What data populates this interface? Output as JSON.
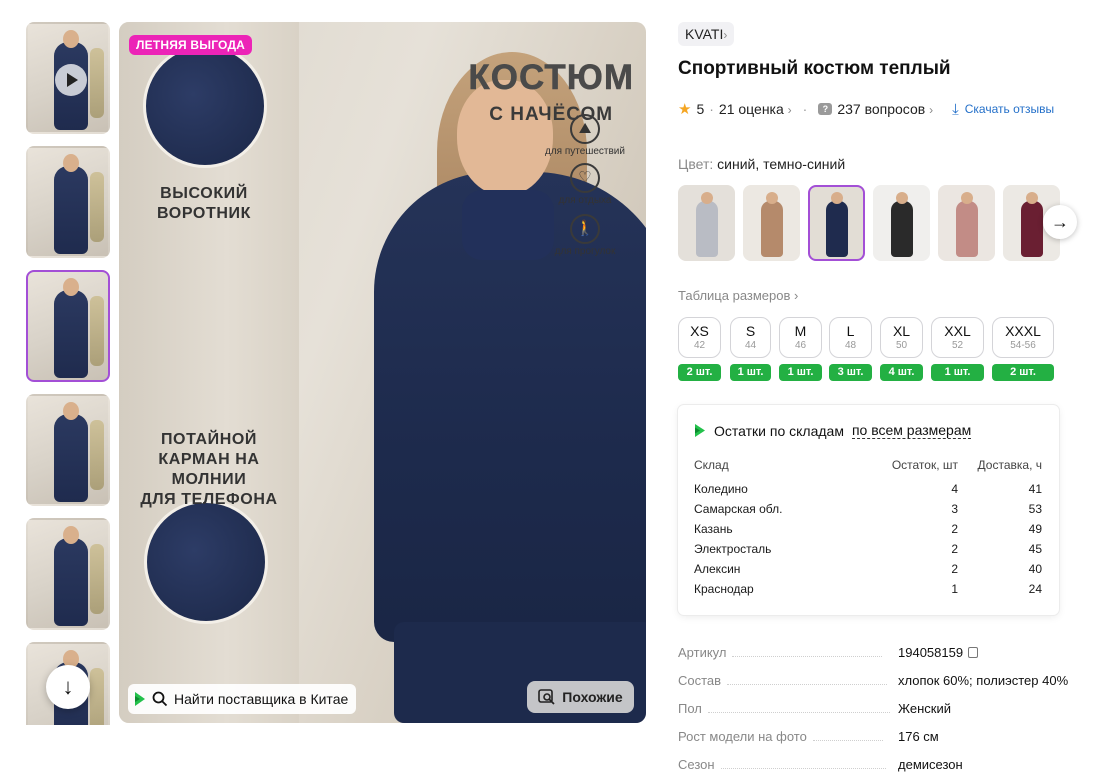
{
  "gallery": {
    "thumbnail_count": 6,
    "active_thumbnail": 3,
    "scroll_down_icon": "arrow-down-icon",
    "play_icon": "play-icon"
  },
  "main_image": {
    "promo_tag": "ЛЕТНЯЯ ВЫГОДА",
    "title_line1": "КОСТЮМ",
    "title_line2": "С НАЧЁСОМ",
    "features": [
      "для путешествий",
      "для отдыха",
      "для прогулок"
    ],
    "caption_collar": "ВЫСОКИЙ\nВОРОТНИК",
    "caption_pocket": "ПОТАЙНОЙ\nКАРМАН НА МОЛНИИ\nДЛЯ ТЕЛЕФОНА",
    "find_supplier_label": "Найти поставщика в Китае",
    "similar_label": "Похожие"
  },
  "product": {
    "brand": "KVATI",
    "title": "Спортивный костюм теплый",
    "rating": "5",
    "reviews": "21 оценка",
    "questions": "237 вопросов",
    "download_reviews": "Скачать отзывы",
    "color_key": "Цвет:",
    "color_value": "синий, темно-синий",
    "size_table_link": "Таблица размеров",
    "sizes": [
      {
        "name": "XS",
        "ru": "42",
        "stock": "2 шт."
      },
      {
        "name": "S",
        "ru": "44",
        "stock": "1 шт."
      },
      {
        "name": "M",
        "ru": "46",
        "stock": "1 шт."
      },
      {
        "name": "L",
        "ru": "48",
        "stock": "3 шт."
      },
      {
        "name": "XL",
        "ru": "50",
        "stock": "4 шт."
      },
      {
        "name": "XXL",
        "ru": "52",
        "stock": "1 шт."
      },
      {
        "name": "XXXL",
        "ru": "54-56",
        "stock": "2 шт."
      }
    ]
  },
  "warehouses": {
    "title": "Остатки по складам",
    "scope": "по всем размерам",
    "headers": [
      "Склад",
      "Остаток, шт",
      "Доставка, ч"
    ],
    "rows": [
      [
        "Коледино",
        "4",
        "41"
      ],
      [
        "Самарская обл.",
        "3",
        "53"
      ],
      [
        "Казань",
        "2",
        "49"
      ],
      [
        "Электросталь",
        "2",
        "45"
      ],
      [
        "Алексин",
        "2",
        "40"
      ],
      [
        "Краснодар",
        "1",
        "24"
      ]
    ]
  },
  "specs": [
    {
      "key": "Артикул",
      "value": "194058159"
    },
    {
      "key": "Состав",
      "value": "хлопок 60%; полиэстер 40%"
    },
    {
      "key": "Пол",
      "value": "Женский"
    },
    {
      "key": "Рост модели на фото",
      "value": "176 см"
    },
    {
      "key": "Сезон",
      "value": "демисезон"
    }
  ],
  "colors": {
    "accent": "#a34fd6",
    "promo": "#ec24b7",
    "stock_green": "#23b043",
    "link_blue": "#2470c9"
  }
}
